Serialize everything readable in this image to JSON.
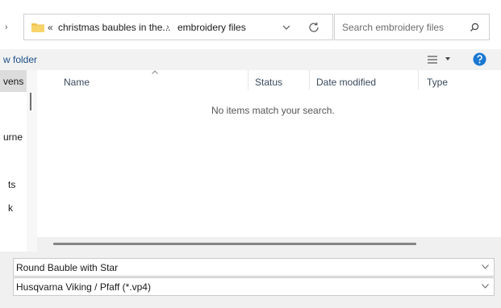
{
  "address": {
    "overflow": "«",
    "breadcrumbs": [
      "christmas baubles in the...",
      "embroidery files"
    ],
    "separator": "›"
  },
  "search": {
    "placeholder": "Search embroidery files"
  },
  "toolbar": {
    "new_folder_label": "w folder"
  },
  "nav_pane": {
    "items": [
      "vens",
      "urne",
      "ts",
      "k"
    ]
  },
  "file_list": {
    "columns": [
      "Name",
      "Status",
      "Date modified",
      "Type"
    ],
    "empty_message": "No items match your search."
  },
  "file_name_field": {
    "value": "Round Bauble with Star"
  },
  "file_type_field": {
    "value": "Husqvarna Viking / Pfaff (*.vp4)"
  },
  "colors": {
    "accent": "#1b4e8c",
    "help_icon": "#1a78d2",
    "folder_icon": "#f0c24a"
  },
  "icons": [
    "back-chevron-icon",
    "folder-icon",
    "chevron-down-icon",
    "refresh-icon",
    "search-icon",
    "view-options-icon",
    "help-icon",
    "sort-up-icon"
  ]
}
